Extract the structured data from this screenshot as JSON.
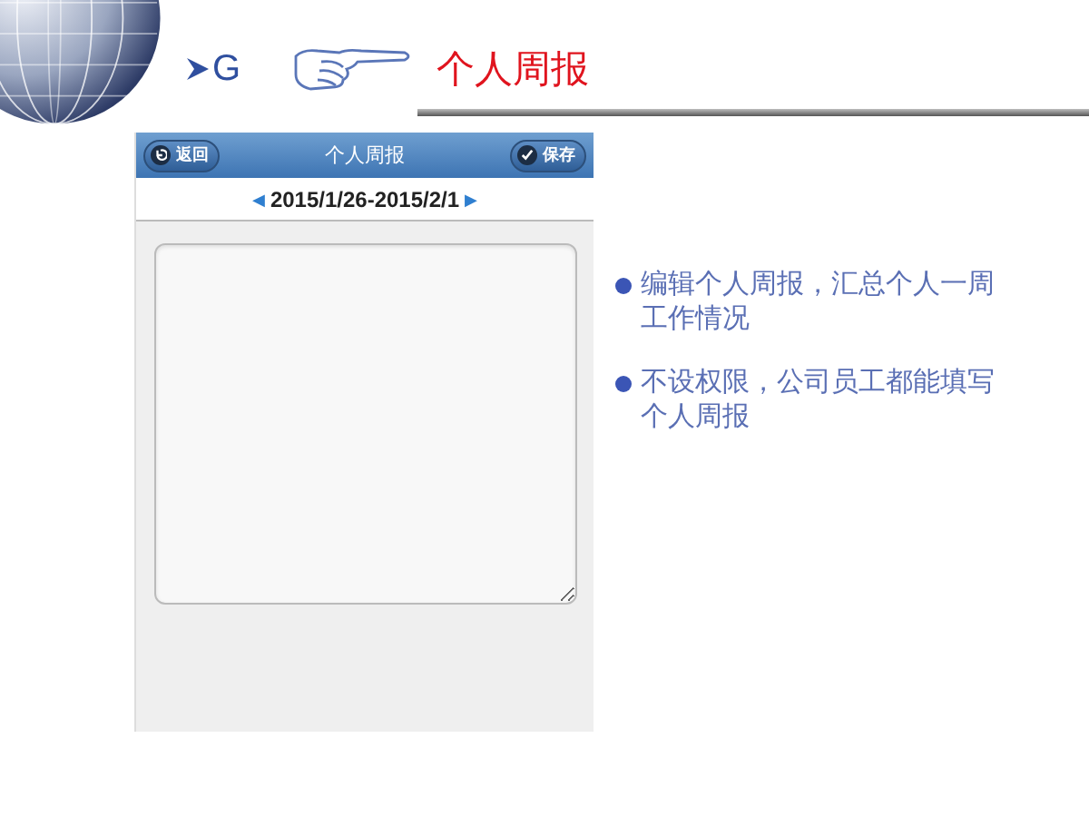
{
  "slide": {
    "section_mark": "G",
    "title": "个人周报"
  },
  "phone": {
    "header": {
      "back_button": "返回",
      "title": "个人周报",
      "save_button": "保存"
    },
    "date_nav": {
      "prev": "◀",
      "range": "2015/1/26-2015/2/1",
      "next": "▶"
    }
  },
  "bullets": [
    "编辑个人周报，汇总个人一周工作情况",
    "不设权限，公司员工都能填写个人周报"
  ]
}
